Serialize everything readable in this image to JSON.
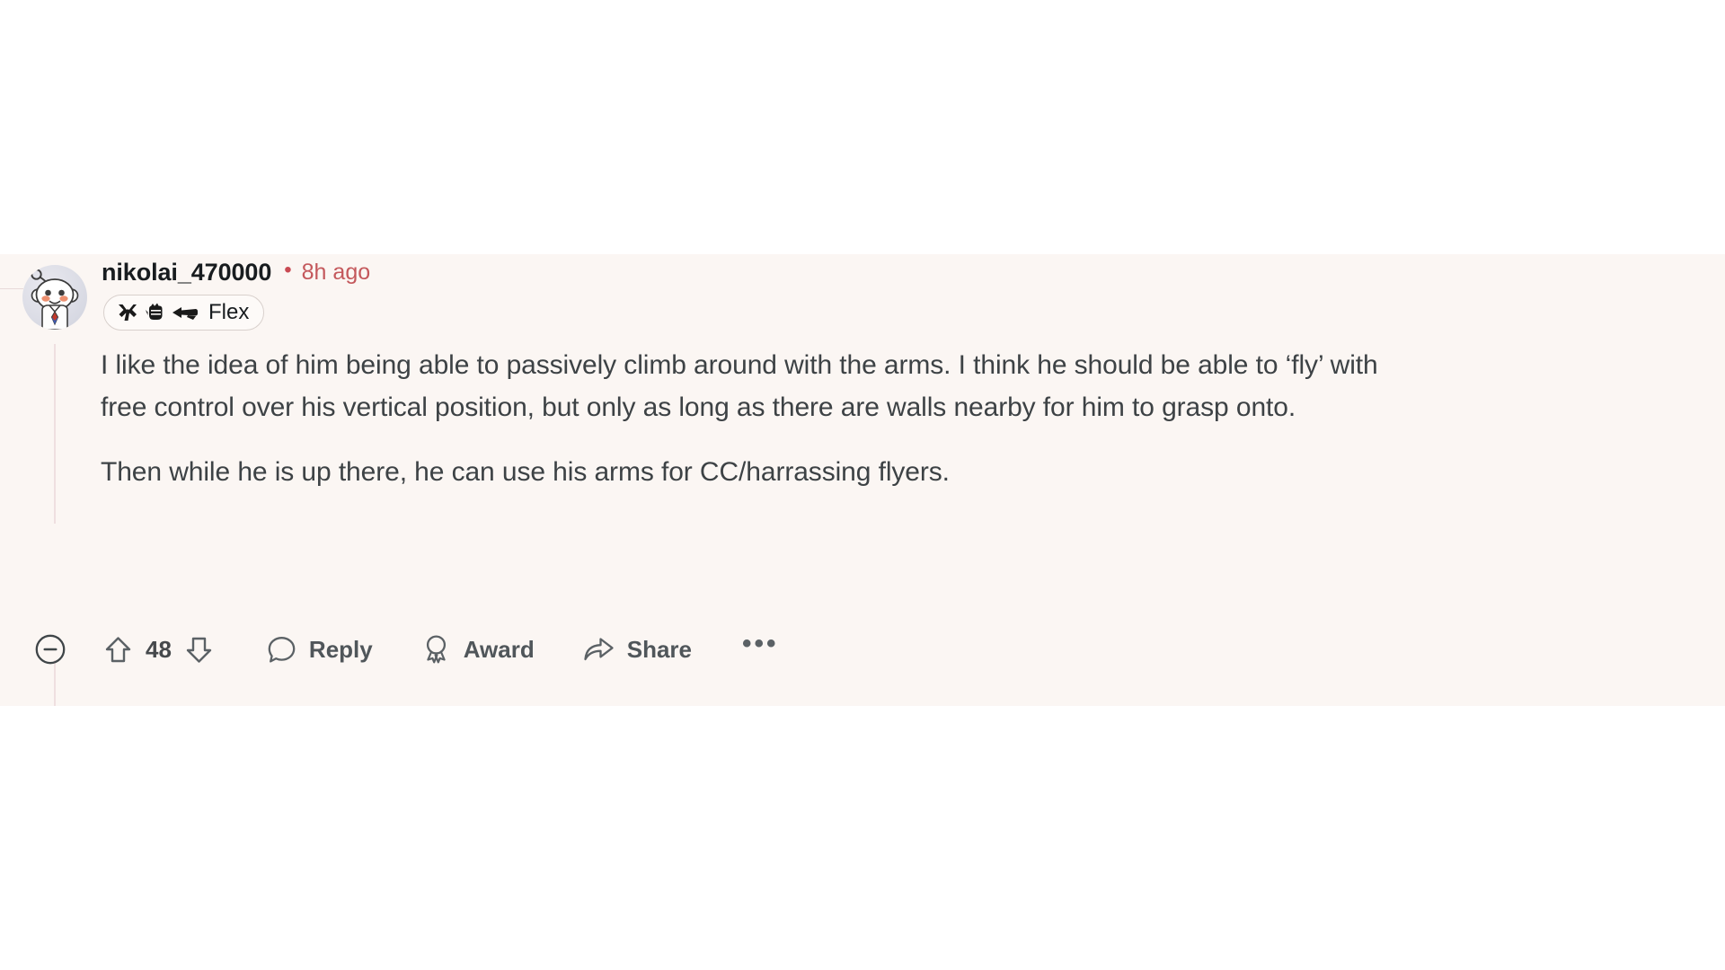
{
  "comment": {
    "avatar": {
      "icon": "reddit-snoo-avatar",
      "background_color": "#dcdde6"
    },
    "author": "nikolai_470000",
    "separator": "•",
    "timestamp": "8h ago",
    "flair": {
      "label": "Flex",
      "emojis": [
        "flexed-arms-emoji",
        "raised-fist-emoji",
        "pointing-hand-emoji"
      ]
    },
    "paragraphs": [
      "I like the idea of him being able to passively climb around with the arms. I think he should be able to ‘fly’ with free control over his vertical position, but only as long as there are walls nearby for him to grasp onto.",
      "Then while he is up there, he can use his arms for CC/harrassing flyers."
    ],
    "actions": {
      "collapse": {
        "icon": "collapse-minus-circle-icon",
        "label": ""
      },
      "upvote": {
        "icon": "upvote-arrow-icon"
      },
      "score": "48",
      "downvote": {
        "icon": "downvote-arrow-icon"
      },
      "reply": {
        "icon": "comment-bubble-icon",
        "label": "Reply"
      },
      "award": {
        "icon": "award-medal-icon",
        "label": "Award"
      },
      "share": {
        "icon": "share-arrow-icon",
        "label": "Share"
      },
      "more": {
        "icon": "overflow-dots-icon",
        "label": "•••"
      }
    }
  },
  "theme": {
    "page_background": "#ffffff",
    "comment_background": "#fbf6f3",
    "text_color": "#3d4245",
    "username_color": "#181c1f",
    "timestamp_color": "#c4585c",
    "thread_line_color": "#efdfe0"
  }
}
